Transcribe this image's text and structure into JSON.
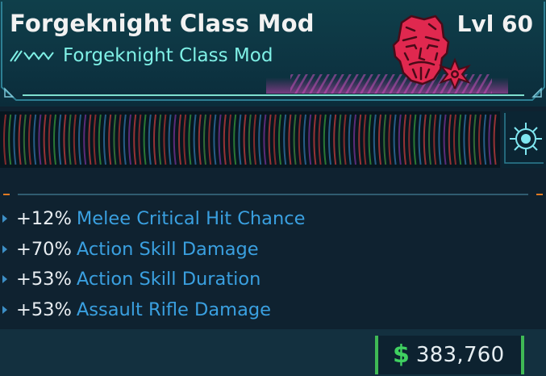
{
  "item": {
    "name": "Forgeknight Class Mod",
    "type": "Forgeknight Class Mod",
    "level": "Lvl 60",
    "portrait_icon": "forgeknight-portrait-icon",
    "rarity_icon": "rarity-chevrons-icon",
    "emblem_icon": "manufacturer-emblem-icon"
  },
  "stats": [
    {
      "value": "+12%",
      "label": "Melee Critical Hit Chance"
    },
    {
      "value": "+70%",
      "label": "Action Skill Damage"
    },
    {
      "value": "+53%",
      "label": "Action Skill Duration"
    },
    {
      "value": "+53%",
      "label": "Assault Rifle Damage"
    }
  ],
  "price": {
    "currency_icon": "dollar-icon",
    "symbol": "$",
    "amount": "383,760"
  },
  "colors": {
    "title": "#f2f2f2",
    "subtitle": "#7ff0e6",
    "stat_label": "#3aa0e0",
    "stat_value": "#e9eef2",
    "portrait": "#e0284f",
    "price_accent": "#3fb955",
    "divider_accent": "#e07a22"
  }
}
